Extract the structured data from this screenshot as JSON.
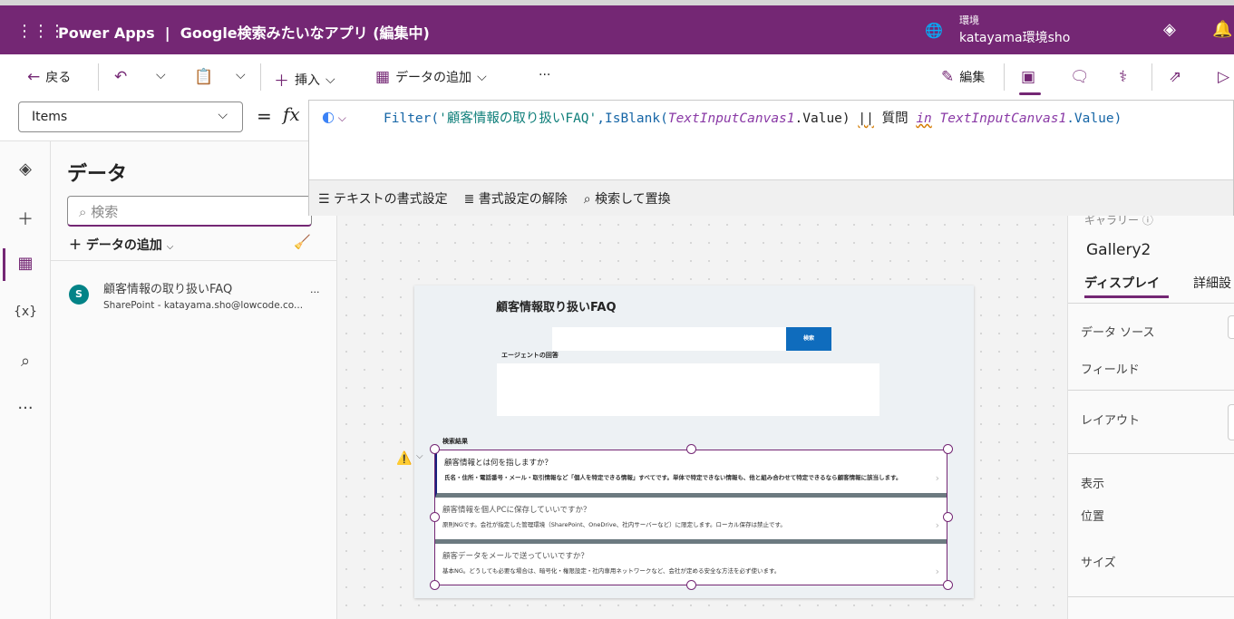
{
  "header": {
    "app": "Power Apps",
    "separator": "|",
    "title": "Google検索みたいなアプリ (編集中)",
    "env_label": "環境",
    "env_name": "katayama環境sho"
  },
  "toolbar": {
    "back": "戻る",
    "insert": "挿入",
    "add_data": "データの追加",
    "more": "···",
    "edit": "編集"
  },
  "formula": {
    "property": "Items",
    "eq": "=",
    "fx": "fx",
    "parts": [
      "Filter(",
      "'顧客情報の取り扱いFAQ'",
      ",IsBlank(",
      "TextInputCanvas1",
      ".Value) ",
      "||",
      " 質問 ",
      "in",
      " ",
      "TextInputCanvas1",
      ".Value)"
    ]
  },
  "format_bar": {
    "text_format": "テキストの書式設定",
    "clear_format": "書式設定の解除",
    "find_replace": "検索して置換"
  },
  "data_panel": {
    "title": "データ",
    "search_placeholder": "検索",
    "add_data": "データの追加",
    "source": {
      "name": "顧客情報の取り扱いFAQ",
      "detail": "SharePoint - katayama.sho@lowcode.co...",
      "more": "···"
    }
  },
  "screen": {
    "title": "顧客情報取り扱いFAQ",
    "search_button": "検索",
    "agent_label": "エージェントの回答",
    "results_label": "検索結果",
    "items": [
      {
        "q": "顧客情報とは何を指しますか？",
        "a": "氏名・住所・電話番号・メール・取引情報など「個人を特定できる情報」すべてです。単体で特定できない情報も、他と組み合わせて特定できるなら顧客情報に該当します。"
      },
      {
        "q": "顧客情報を個人PCに保存していいですか？",
        "a": "原則NGです。会社が指定した管理環境（SharePoint、OneDrive、社内サーバーなど）に限定します。ローカル保存は禁止です。"
      },
      {
        "q": "顧客データをメールで送っていいですか？",
        "a": "基本NG。どうしても必要な場合は、暗号化・権限設定・社内専用ネットワークなど、会社が定める安全な方法を必ず使います。"
      }
    ]
  },
  "right_panel": {
    "type": "ギャラリー",
    "name": "Gallery2",
    "tab_display": "ディスプレイ",
    "tab_advanced": "詳細設",
    "data_source": "データ ソース",
    "fields": "フィールド",
    "layout": "レイアウト",
    "visible": "表示",
    "position": "位置",
    "size": "サイズ"
  },
  "colors": {
    "brand": "#742774",
    "button": "#0f6cbd"
  }
}
